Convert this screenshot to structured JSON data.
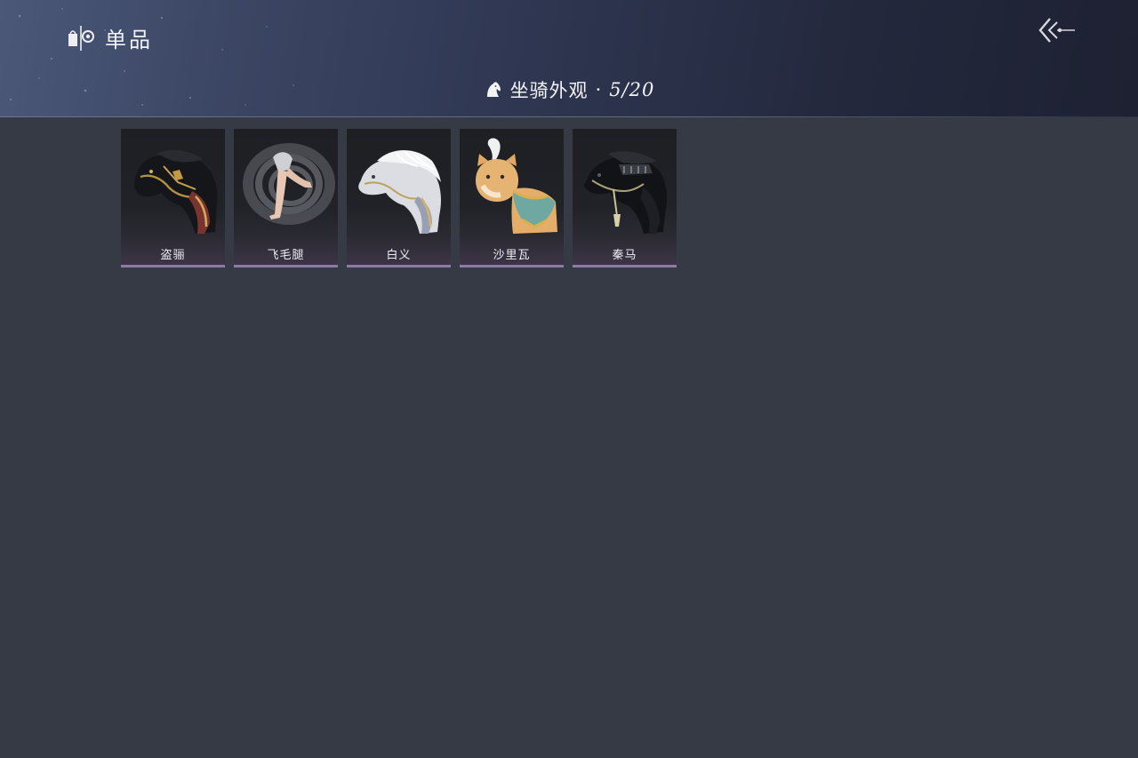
{
  "header": {
    "title": "单品",
    "brand_icon": "bag-eye-icon",
    "back_icon": "double-chevron-left-icon"
  },
  "section": {
    "icon": "horse-head-icon",
    "name": "坐骑外观",
    "separator": "·",
    "count": "5/20"
  },
  "items": [
    {
      "name": "盗骊",
      "art": "dark-armored-horse"
    },
    {
      "name": "飞毛腿",
      "art": "spinning-legs"
    },
    {
      "name": "白义",
      "art": "white-armored-horse"
    },
    {
      "name": "沙里瓦",
      "art": "orange-cat-mount"
    },
    {
      "name": "秦马",
      "art": "black-armored-horse"
    }
  ],
  "colors": {
    "background": "#363a44",
    "card_accent": "#8e7aa6",
    "text": "#f2f2f4"
  }
}
